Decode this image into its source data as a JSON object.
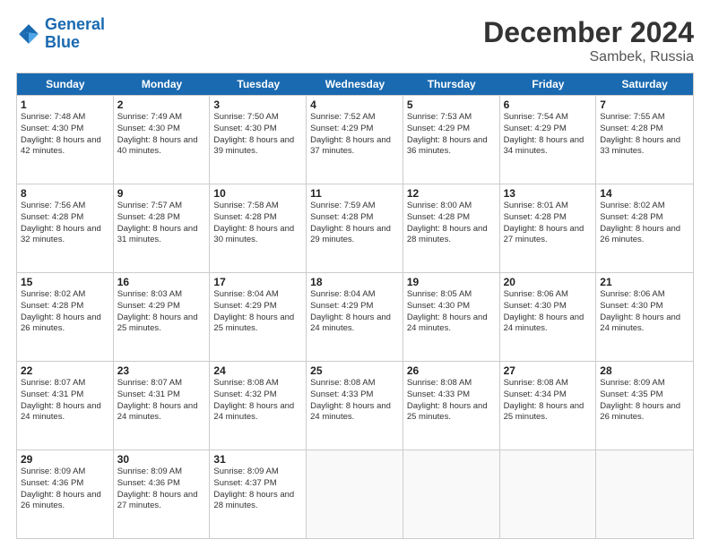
{
  "logo": {
    "line1": "General",
    "line2": "Blue"
  },
  "title": "December 2024",
  "subtitle": "Sambek, Russia",
  "header": {
    "days": [
      "Sunday",
      "Monday",
      "Tuesday",
      "Wednesday",
      "Thursday",
      "Friday",
      "Saturday"
    ]
  },
  "weeks": [
    [
      {
        "day": "1",
        "sunrise": "7:48 AM",
        "sunset": "4:30 PM",
        "daylight": "8 hours and 42 minutes."
      },
      {
        "day": "2",
        "sunrise": "7:49 AM",
        "sunset": "4:30 PM",
        "daylight": "8 hours and 40 minutes."
      },
      {
        "day": "3",
        "sunrise": "7:50 AM",
        "sunset": "4:30 PM",
        "daylight": "8 hours and 39 minutes."
      },
      {
        "day": "4",
        "sunrise": "7:52 AM",
        "sunset": "4:29 PM",
        "daylight": "8 hours and 37 minutes."
      },
      {
        "day": "5",
        "sunrise": "7:53 AM",
        "sunset": "4:29 PM",
        "daylight": "8 hours and 36 minutes."
      },
      {
        "day": "6",
        "sunrise": "7:54 AM",
        "sunset": "4:29 PM",
        "daylight": "8 hours and 34 minutes."
      },
      {
        "day": "7",
        "sunrise": "7:55 AM",
        "sunset": "4:28 PM",
        "daylight": "8 hours and 33 minutes."
      }
    ],
    [
      {
        "day": "8",
        "sunrise": "7:56 AM",
        "sunset": "4:28 PM",
        "daylight": "8 hours and 32 minutes."
      },
      {
        "day": "9",
        "sunrise": "7:57 AM",
        "sunset": "4:28 PM",
        "daylight": "8 hours and 31 minutes."
      },
      {
        "day": "10",
        "sunrise": "7:58 AM",
        "sunset": "4:28 PM",
        "daylight": "8 hours and 30 minutes."
      },
      {
        "day": "11",
        "sunrise": "7:59 AM",
        "sunset": "4:28 PM",
        "daylight": "8 hours and 29 minutes."
      },
      {
        "day": "12",
        "sunrise": "8:00 AM",
        "sunset": "4:28 PM",
        "daylight": "8 hours and 28 minutes."
      },
      {
        "day": "13",
        "sunrise": "8:01 AM",
        "sunset": "4:28 PM",
        "daylight": "8 hours and 27 minutes."
      },
      {
        "day": "14",
        "sunrise": "8:02 AM",
        "sunset": "4:28 PM",
        "daylight": "8 hours and 26 minutes."
      }
    ],
    [
      {
        "day": "15",
        "sunrise": "8:02 AM",
        "sunset": "4:28 PM",
        "daylight": "8 hours and 26 minutes."
      },
      {
        "day": "16",
        "sunrise": "8:03 AM",
        "sunset": "4:29 PM",
        "daylight": "8 hours and 25 minutes."
      },
      {
        "day": "17",
        "sunrise": "8:04 AM",
        "sunset": "4:29 PM",
        "daylight": "8 hours and 25 minutes."
      },
      {
        "day": "18",
        "sunrise": "8:04 AM",
        "sunset": "4:29 PM",
        "daylight": "8 hours and 24 minutes."
      },
      {
        "day": "19",
        "sunrise": "8:05 AM",
        "sunset": "4:30 PM",
        "daylight": "8 hours and 24 minutes."
      },
      {
        "day": "20",
        "sunrise": "8:06 AM",
        "sunset": "4:30 PM",
        "daylight": "8 hours and 24 minutes."
      },
      {
        "day": "21",
        "sunrise": "8:06 AM",
        "sunset": "4:30 PM",
        "daylight": "8 hours and 24 minutes."
      }
    ],
    [
      {
        "day": "22",
        "sunrise": "8:07 AM",
        "sunset": "4:31 PM",
        "daylight": "8 hours and 24 minutes."
      },
      {
        "day": "23",
        "sunrise": "8:07 AM",
        "sunset": "4:31 PM",
        "daylight": "8 hours and 24 minutes."
      },
      {
        "day": "24",
        "sunrise": "8:08 AM",
        "sunset": "4:32 PM",
        "daylight": "8 hours and 24 minutes."
      },
      {
        "day": "25",
        "sunrise": "8:08 AM",
        "sunset": "4:33 PM",
        "daylight": "8 hours and 24 minutes."
      },
      {
        "day": "26",
        "sunrise": "8:08 AM",
        "sunset": "4:33 PM",
        "daylight": "8 hours and 25 minutes."
      },
      {
        "day": "27",
        "sunrise": "8:08 AM",
        "sunset": "4:34 PM",
        "daylight": "8 hours and 25 minutes."
      },
      {
        "day": "28",
        "sunrise": "8:09 AM",
        "sunset": "4:35 PM",
        "daylight": "8 hours and 26 minutes."
      }
    ],
    [
      {
        "day": "29",
        "sunrise": "8:09 AM",
        "sunset": "4:36 PM",
        "daylight": "8 hours and 26 minutes."
      },
      {
        "day": "30",
        "sunrise": "8:09 AM",
        "sunset": "4:36 PM",
        "daylight": "8 hours and 27 minutes."
      },
      {
        "day": "31",
        "sunrise": "8:09 AM",
        "sunset": "4:37 PM",
        "daylight": "8 hours and 28 minutes."
      },
      null,
      null,
      null,
      null
    ]
  ]
}
